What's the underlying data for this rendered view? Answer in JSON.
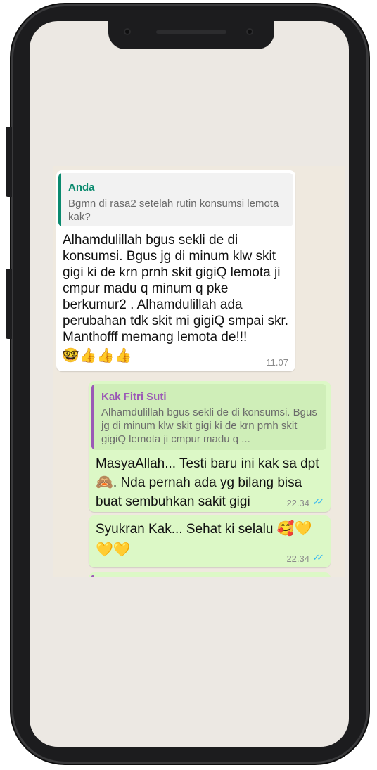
{
  "messages": [
    {
      "quote_name": "Anda",
      "quote_text": "Bgmn di rasa2 setelah rutin konsumsi lemota kak?",
      "text": "Alhamdulillah bgus sekli de di konsumsi. Bgus jg di minum klw skit gigi ki de krn prnh skit gigiQ lemota ji cmpur madu q minum q pke berkumur2 . Alhamdulillah ada perubahan tdk skit mi gigiQ smpai skr. Manthofff memang lemota de!!!",
      "emojis": "🤓👍👍👍",
      "time": "11.07"
    },
    {
      "quote_name": "Kak Fitri Suti",
      "quote_text": "Alhamdulillah bgus sekli de di konsumsi. Bgus jg di minum klw skit gigi ki de krn prnh skit gigiQ lemota ji cmpur madu q ...",
      "text_a": "MasyaAllah... Testi baru ini kak sa dpt",
      "emoji": "🙈",
      "text_b": ". Nda pernah ada yg bilang bisa buat sembuhkan sakit gigi",
      "time": "22.34"
    },
    {
      "text": "Syukran Kak... Sehat ki selalu",
      "emojis_a": "🥰💛",
      "emojis_b": "💛💛",
      "time": "22.34"
    }
  ],
  "colors": {
    "screen_bg": "#ece8e3",
    "chat_bg": "#efe9df",
    "incoming": "#ffffff",
    "outgoing": "#dcf8c6",
    "self_quote_accent": "#0a8a6e",
    "contact_quote_accent": "#9b59b6",
    "read_ticks": "#34b7f1"
  },
  "icons": [
    "double-check-icon"
  ]
}
